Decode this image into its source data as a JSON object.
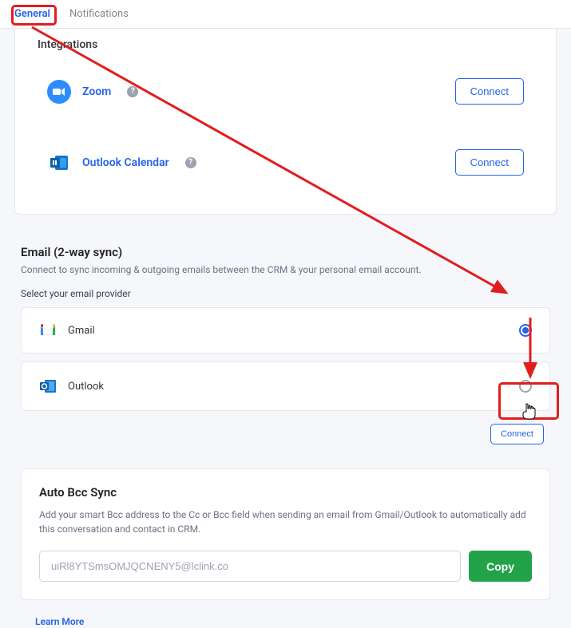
{
  "tabs": {
    "general": "General",
    "notifications": "Notifications"
  },
  "integrations": {
    "heading": "Integrations",
    "zoom": {
      "title": "Zoom",
      "connect": "Connect"
    },
    "outlook_calendar": {
      "title": "Outlook Calendar",
      "connect": "Connect"
    }
  },
  "email": {
    "heading": "Email (2-way sync)",
    "desc": "Connect to sync incoming & outgoing emails between the CRM & your personal email account.",
    "provider_label": "Select your email provider",
    "providers": {
      "gmail": "Gmail",
      "outlook": "Outlook"
    },
    "connect": "Connect"
  },
  "bcc": {
    "title": "Auto Bcc Sync",
    "desc": "Add your smart Bcc address to the Cc or Bcc field when sending an email from Gmail/Outlook to automatically add this conversation and contact in CRM.",
    "value": "uiRl8YTSmsOMJQCNENY5@lclink.co",
    "copy": "Copy"
  },
  "learn_more": "Learn More"
}
